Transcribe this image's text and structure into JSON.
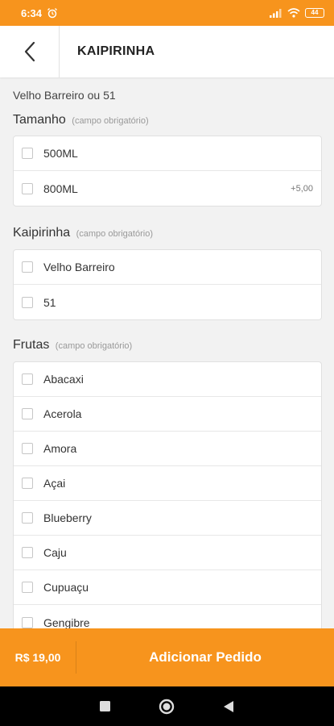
{
  "status_bar": {
    "time": "6:34",
    "battery": "44"
  },
  "header": {
    "title": "KAIPIRINHA"
  },
  "subtitle": "Velho Barreiro ou 51",
  "groups": [
    {
      "title": "Tamanho",
      "required": "(campo obrigatório)",
      "options": [
        {
          "label": "500ML",
          "price": ""
        },
        {
          "label": "800ML",
          "price": "+5,00"
        }
      ]
    },
    {
      "title": "Kaipirinha",
      "required": "(campo obrigatório)",
      "options": [
        {
          "label": "Velho Barreiro",
          "price": ""
        },
        {
          "label": "51",
          "price": ""
        }
      ]
    },
    {
      "title": "Frutas",
      "required": "(campo obrigatório)",
      "options": [
        {
          "label": "Abacaxi",
          "price": ""
        },
        {
          "label": "Acerola",
          "price": ""
        },
        {
          "label": "Amora",
          "price": ""
        },
        {
          "label": "Açai",
          "price": ""
        },
        {
          "label": "Blueberry",
          "price": ""
        },
        {
          "label": "Caju",
          "price": ""
        },
        {
          "label": "Cupuaçu",
          "price": ""
        },
        {
          "label": "Gengibre",
          "price": ""
        }
      ]
    }
  ],
  "footer": {
    "total": "R$ 19,00",
    "add_label": "Adicionar Pedido"
  },
  "colors": {
    "accent": "#f7941d",
    "nav_bar": "#000000"
  }
}
